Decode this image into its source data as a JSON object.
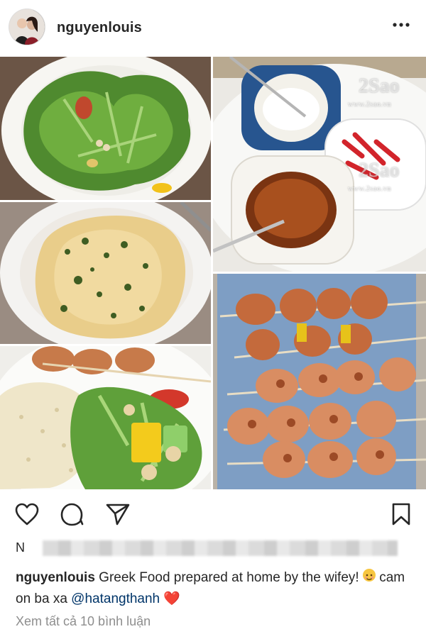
{
  "post": {
    "username": "nguyenlouis",
    "more_icon": "more-horizontal-icon"
  },
  "collage": {
    "tiles": [
      "salad",
      "sauces",
      "couscous",
      "shrimp-skewers",
      "plated-meal"
    ],
    "watermark_brand": "2Sao",
    "watermark_url": "www.2sao.vn"
  },
  "actions": {
    "like_icon": "heart-icon",
    "comment_icon": "comment-icon",
    "share_icon": "send-icon",
    "save_icon": "bookmark-icon"
  },
  "likes": {
    "prefix": "N"
  },
  "caption": {
    "username": "nguyenlouis",
    "text_1": " Greek Food prepared at home by the wifey! ",
    "text_2": "  cam on ba xa ",
    "mention": "@hatangthanh",
    "heart": "❤️"
  },
  "comments": {
    "view_all": "Xem tất cả 10 bình luận"
  }
}
